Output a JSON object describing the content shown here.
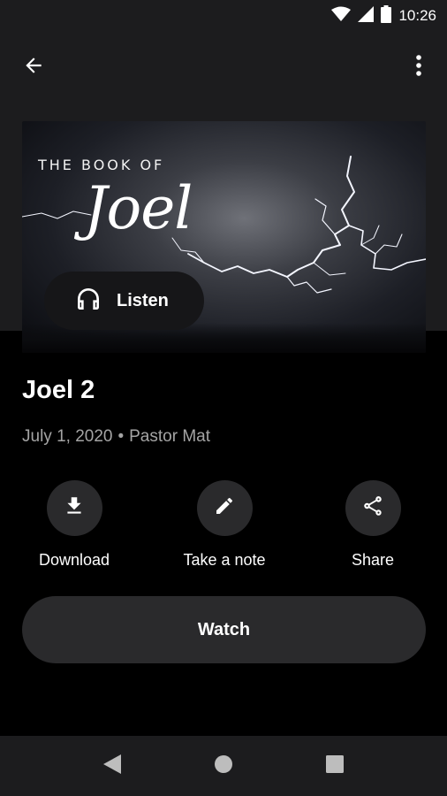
{
  "status_bar": {
    "time": "10:26",
    "icons": [
      "wifi-icon",
      "cell-signal-icon",
      "battery-icon"
    ]
  },
  "app_bar": {
    "back_icon": "arrow-back-icon",
    "menu_icon": "more-vertical-icon"
  },
  "hero": {
    "image_subtitle": "THE BOOK OF",
    "image_title": "Joel",
    "listen_label": "Listen",
    "listen_icon": "headphones-icon"
  },
  "sermon": {
    "title": "Joel 2",
    "date": "July 1, 2020",
    "separator": "•",
    "speaker": "Pastor Mat"
  },
  "actions": [
    {
      "label": "Download",
      "icon": "download-icon"
    },
    {
      "label": "Take a note",
      "icon": "pencil-icon"
    },
    {
      "label": "Share",
      "icon": "share-icon"
    }
  ],
  "watch": {
    "label": "Watch"
  },
  "nav": {
    "icons": [
      "nav-back-icon",
      "nav-home-icon",
      "nav-recents-icon"
    ]
  },
  "colors": {
    "background": "#000000",
    "surface": "#1c1c1e",
    "button": "#2a2a2c",
    "secondary_text": "#a4a4a4"
  }
}
